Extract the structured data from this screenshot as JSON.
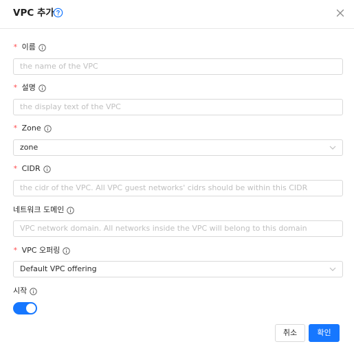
{
  "dialog": {
    "title": "VPC 추가",
    "cancel_label": "취소",
    "ok_label": "확인"
  },
  "fields": {
    "name": {
      "label": "이름",
      "required": true,
      "placeholder": "the name of the VPC"
    },
    "description": {
      "label": "설명",
      "required": true,
      "placeholder": "the display text of the VPC"
    },
    "zone": {
      "label": "Zone",
      "required": true,
      "value": "zone"
    },
    "cidr": {
      "label": "CIDR",
      "required": true,
      "placeholder": "the cidr of the VPC. All VPC guest networks' cidrs should be within this CIDR"
    },
    "network_domain": {
      "label": "네트워크 도메인",
      "required": false,
      "placeholder": "VPC network domain. All networks inside the VPC will belong to this domain"
    },
    "vpc_offering": {
      "label": "VPC 오퍼링",
      "required": true,
      "value": "Default VPC offering"
    },
    "start": {
      "label": "시작",
      "required": false,
      "enabled": true
    }
  },
  "icons": {
    "help": "question-circle-icon",
    "close": "close-icon",
    "info": "info-circle-icon",
    "dropdown": "chevron-down-icon"
  },
  "colors": {
    "primary": "#1677ff",
    "required": "#ff4d4f",
    "border": "#d9d9d9",
    "placeholder": "#bfbfbf"
  },
  "required_mark": "*"
}
